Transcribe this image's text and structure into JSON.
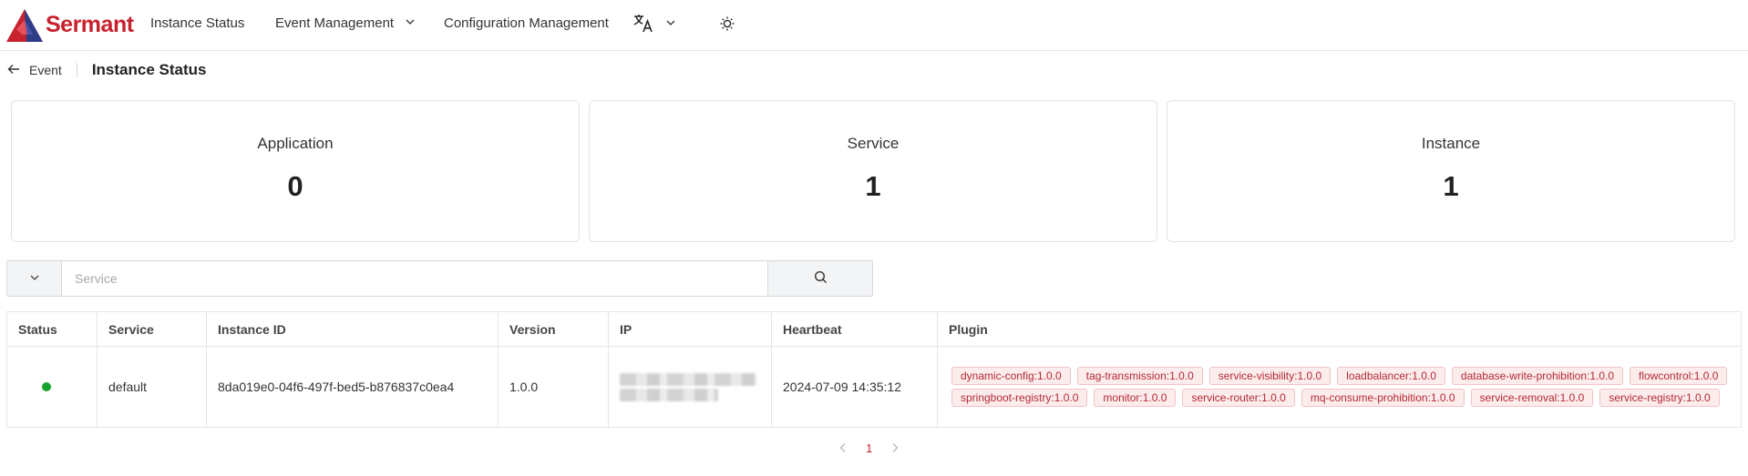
{
  "app": {
    "brand": "Sermant",
    "brand_color": "#c7222e"
  },
  "nav": {
    "instance_status": "Instance Status",
    "event_management": "Event Management",
    "configuration_management": "Configuration Management",
    "language_icon": "translate-icon",
    "theme_icon": "sun-icon"
  },
  "breadcrumb": {
    "back_label": "Event",
    "title": "Instance Status"
  },
  "stats": [
    {
      "label": "Application",
      "value": "0"
    },
    {
      "label": "Service",
      "value": "1"
    },
    {
      "label": "Instance",
      "value": "1"
    }
  ],
  "search": {
    "placeholder": "Service",
    "value": ""
  },
  "table": {
    "columns": [
      "Status",
      "Service",
      "Instance ID",
      "Version",
      "IP",
      "Heartbeat",
      "Plugin"
    ],
    "rows": [
      {
        "status": "online",
        "status_color": "#17a22d",
        "service": "default",
        "instance_id": "8da019e0-04f6-497f-bed5-b876837c0ea4",
        "version": "1.0.0",
        "heartbeat": "2024-07-09 14:35:12",
        "plugins": [
          "dynamic-config:1.0.0",
          "tag-transmission:1.0.0",
          "service-visibility:1.0.0",
          "loadbalancer:1.0.0",
          "database-write-prohibition:1.0.0",
          "flowcontrol:1.0.0",
          "springboot-registry:1.0.0",
          "monitor:1.0.0",
          "service-router:1.0.0",
          "mq-consume-prohibition:1.0.0",
          "service-removal:1.0.0",
          "service-registry:1.0.0"
        ]
      }
    ]
  },
  "pagination": {
    "current_page": "1"
  }
}
